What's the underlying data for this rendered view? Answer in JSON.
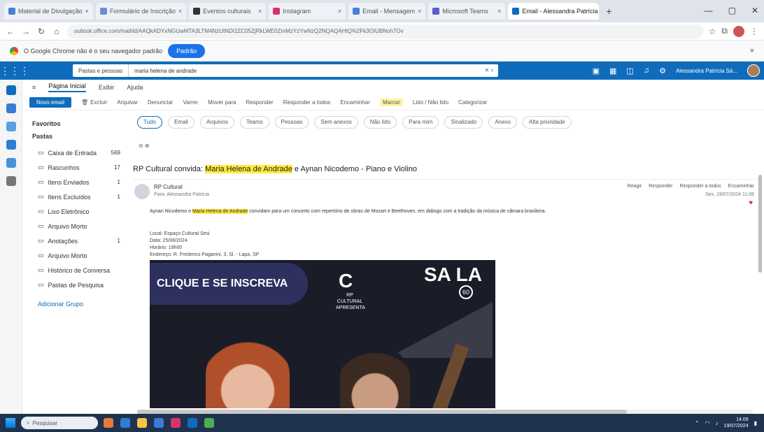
{
  "browser": {
    "tabs": [
      {
        "label": "Material de Divulgação",
        "color": "#4a7fd4",
        "active": false
      },
      {
        "label": "Formulário de Inscrição",
        "color": "#6a8fd0",
        "active": false
      },
      {
        "label": "Eventos culturais",
        "color": "#333333",
        "active": false
      },
      {
        "label": "Instagram",
        "color": "#d6336c",
        "active": false
      },
      {
        "label": "Email - Mensagem",
        "color": "#4a7fd4",
        "active": false
      },
      {
        "label": "Microsoft Teams",
        "color": "#5b5fc7",
        "active": false
      },
      {
        "label": "Email - Alessandra Patrícia",
        "color": "#0f6cbd",
        "active": true
      }
    ],
    "new_tab": "+",
    "url": "outlook.office.com/mail/id/AAQkADYxNGUwMTA3LTM4NzUtNDI2ZC05ZjRkLWE0ZmMzYzYwNzQ2NQAQAHtQ%2Fk3OIUBNoh7Ov",
    "infobar_text": "O Google Chrome não é o seu navegador padrão",
    "infobar_button": "Padrão",
    "infobar_close": "×"
  },
  "owa": {
    "waffle": "⋮⋮⋮",
    "search_scope": "Pastas e pessoas",
    "search_query": "maria helena de andrade",
    "user_name": "Alessandra Patrícia Sá...",
    "ribbon_tabs": [
      "Página Inicial",
      "Exibir",
      "Ajuda"
    ],
    "new_mail": "Novo email",
    "ribbon": [
      "Excluir",
      "Arquivar",
      "Denunciar",
      "Varrer",
      "Mover para",
      "Responder",
      "Responder a todos",
      "Encaminhar",
      "Marcar",
      "Lido / Não lido",
      "Categorizar"
    ],
    "ribbon_highlight": "Marcar"
  },
  "folders": {
    "favorites": "Favoritos",
    "pastas": "Pastas",
    "items": [
      {
        "label": "Caixa de Entrada",
        "count": "569"
      },
      {
        "label": "Rascunhos",
        "count": "17"
      },
      {
        "label": "Itens Enviados",
        "count": "1"
      },
      {
        "label": "Itens Excluídos",
        "count": "1"
      },
      {
        "label": "Lixo Eletrônico",
        "count": ""
      },
      {
        "label": "Arquivo Morto",
        "count": ""
      },
      {
        "label": "Anotações",
        "count": "1"
      },
      {
        "label": "Arquivo Morto",
        "count": ""
      },
      {
        "label": "Histórico de Conversa",
        "count": ""
      },
      {
        "label": "Pastas de Pesquisa",
        "count": ""
      }
    ],
    "add_group": "Adicionar Grupo"
  },
  "reading": {
    "filters": [
      "Tudo",
      "Email",
      "Arquivos",
      "Teams",
      "Pessoas",
      "Sem anexos",
      "Não lido",
      "Para mim",
      "Sinalizado",
      "Anexo",
      "Alta prioridade"
    ],
    "zoom": "⊖ ⊕",
    "subject_prefix": "RP Cultural convida: ",
    "subject_highlight": "Maria Helena de Andrade",
    "subject_suffix": " e Aynan Nicodemo - Piano e Violino",
    "sender": "RP Cultural",
    "to_line": "Para: Alessandra Patrícia",
    "actions": [
      "Reagir",
      "Responder",
      "Responder a todos",
      "Encaminhar"
    ],
    "date": "Sex, 19/07/2024 11:08",
    "heart": "♥",
    "body_prefix": "Aynan Nicodemo e ",
    "body_highlight": "Maria Helena de Andrade",
    "body_suffix": " convidam para um concerto com repertório de obras de Mozart e Beethoven, em diálogo com a tradição da música de câmara brasileira.",
    "event_lines": [
      "Local: Espaço Cultural Sesi",
      "Data: 25/08/2024",
      "Horário: 19h00",
      "Endereço: R. Frederico Paganini, 3, Sl. - Lapa, SP"
    ],
    "banner_cta": "CLIQUE E SE INSCREVA",
    "banner_logo": "C",
    "banner_logo_text": "RP CULTURAL APRESENTA",
    "banner_sala": "SA LA",
    "banner_60": "60"
  },
  "taskbar": {
    "search": "Pesquisar",
    "time": "14:09",
    "date": "19/07/2024",
    "apps": [
      "#e57c3a",
      "#2d7dd2",
      "#f4c542",
      "#3a7bd5",
      "#d6336c",
      "#0f6cbd",
      "#4caf50"
    ]
  }
}
